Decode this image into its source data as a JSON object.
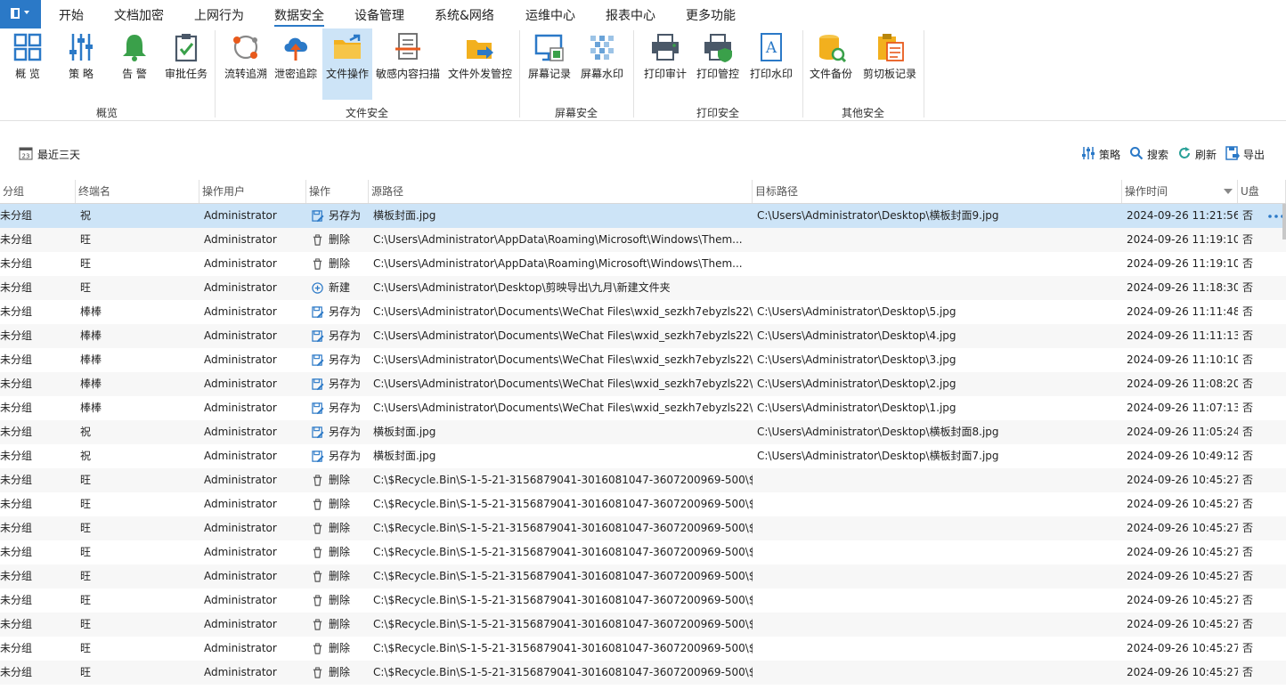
{
  "menu": {
    "items": [
      "开始",
      "文档加密",
      "上网行为",
      "数据安全",
      "设备管理",
      "系统&网络",
      "运维中心",
      "报表中心",
      "更多功能"
    ],
    "active_index": 3
  },
  "ribbon": {
    "groups": [
      {
        "label": "概览",
        "buttons": [
          {
            "label": "概 览",
            "icon": "overview-icon"
          },
          {
            "label": "策 略",
            "icon": "policy-sliders-icon"
          },
          {
            "label": "告 警",
            "icon": "alert-bell-icon"
          },
          {
            "label": "审批任务",
            "icon": "approval-clipboard-icon"
          }
        ]
      },
      {
        "label": "文件安全",
        "buttons": [
          {
            "label": "流转追溯",
            "icon": "flow-trace-icon"
          },
          {
            "label": "泄密追踪",
            "icon": "leak-trace-cloud-icon"
          },
          {
            "label": "文件操作",
            "icon": "file-operation-folder-icon"
          },
          {
            "label": "敏感内容扫描",
            "icon": "sensitive-scan-icon"
          },
          {
            "label": "文件外发管控",
            "icon": "file-outbound-icon"
          }
        ]
      },
      {
        "label": "屏幕安全",
        "buttons": [
          {
            "label": "屏幕记录",
            "icon": "screen-record-icon"
          },
          {
            "label": "屏幕水印",
            "icon": "screen-watermark-icon"
          }
        ]
      },
      {
        "label": "打印安全",
        "buttons": [
          {
            "label": "打印审计",
            "icon": "print-audit-icon"
          },
          {
            "label": "打印管控",
            "icon": "print-control-icon"
          },
          {
            "label": "打印水印",
            "icon": "print-watermark-icon"
          }
        ]
      },
      {
        "label": "其他安全",
        "buttons": [
          {
            "label": "文件备份",
            "icon": "file-backup-icon"
          },
          {
            "label": "剪切板记录",
            "icon": "clipboard-record-icon"
          }
        ]
      }
    ],
    "active_button": "文件操作"
  },
  "toolbar": {
    "date_filter": "最近三天",
    "policy": "策略",
    "search": "搜索",
    "refresh": "刷新",
    "export": "导出"
  },
  "table": {
    "columns": [
      "分组",
      "终端名",
      "操作用户",
      "操作",
      "源路径",
      "目标路径",
      "操作时间",
      "U盘"
    ],
    "sorted_column": "操作时间",
    "rows": [
      {
        "group": "未分组",
        "terminal": "祝",
        "user": "Administrator",
        "op": "另存为",
        "op_icon": "save-as-icon",
        "src": "横板封面.jpg",
        "dst": "C:\\Users\\Administrator\\Desktop\\横板封面9.jpg",
        "time": "2024-09-26 11:21:56",
        "usb": "否"
      },
      {
        "group": "未分组",
        "terminal": "旺",
        "user": "Administrator",
        "op": "删除",
        "op_icon": "delete-trash-icon",
        "src": "C:\\Users\\Administrator\\AppData\\Roaming\\Microsoft\\Windows\\Them...",
        "dst": "",
        "time": "2024-09-26 11:19:10",
        "usb": "否"
      },
      {
        "group": "未分组",
        "terminal": "旺",
        "user": "Administrator",
        "op": "删除",
        "op_icon": "delete-trash-icon",
        "src": "C:\\Users\\Administrator\\AppData\\Roaming\\Microsoft\\Windows\\Them...",
        "dst": "",
        "time": "2024-09-26 11:19:10",
        "usb": "否"
      },
      {
        "group": "未分组",
        "terminal": "旺",
        "user": "Administrator",
        "op": "新建",
        "op_icon": "new-plus-icon",
        "src": "C:\\Users\\Administrator\\Desktop\\剪映导出\\九月\\新建文件夹",
        "dst": "",
        "time": "2024-09-26 11:18:30",
        "usb": "否"
      },
      {
        "group": "未分组",
        "terminal": "棒棒",
        "user": "Administrator",
        "op": "另存为",
        "op_icon": "save-as-icon",
        "src": "C:\\Users\\Administrator\\Documents\\WeChat Files\\wxid_sezkh7ebyzls22\\...",
        "dst": "C:\\Users\\Administrator\\Desktop\\5.jpg",
        "time": "2024-09-26 11:11:48",
        "usb": "否"
      },
      {
        "group": "未分组",
        "terminal": "棒棒",
        "user": "Administrator",
        "op": "另存为",
        "op_icon": "save-as-icon",
        "src": "C:\\Users\\Administrator\\Documents\\WeChat Files\\wxid_sezkh7ebyzls22\\...",
        "dst": "C:\\Users\\Administrator\\Desktop\\4.jpg",
        "time": "2024-09-26 11:11:13",
        "usb": "否"
      },
      {
        "group": "未分组",
        "terminal": "棒棒",
        "user": "Administrator",
        "op": "另存为",
        "op_icon": "save-as-icon",
        "src": "C:\\Users\\Administrator\\Documents\\WeChat Files\\wxid_sezkh7ebyzls22\\...",
        "dst": "C:\\Users\\Administrator\\Desktop\\3.jpg",
        "time": "2024-09-26 11:10:10",
        "usb": "否"
      },
      {
        "group": "未分组",
        "terminal": "棒棒",
        "user": "Administrator",
        "op": "另存为",
        "op_icon": "save-as-icon",
        "src": "C:\\Users\\Administrator\\Documents\\WeChat Files\\wxid_sezkh7ebyzls22\\...",
        "dst": "C:\\Users\\Administrator\\Desktop\\2.jpg",
        "time": "2024-09-26 11:08:20",
        "usb": "否"
      },
      {
        "group": "未分组",
        "terminal": "棒棒",
        "user": "Administrator",
        "op": "另存为",
        "op_icon": "save-as-icon",
        "src": "C:\\Users\\Administrator\\Documents\\WeChat Files\\wxid_sezkh7ebyzls22\\...",
        "dst": "C:\\Users\\Administrator\\Desktop\\1.jpg",
        "time": "2024-09-26 11:07:13",
        "usb": "否"
      },
      {
        "group": "未分组",
        "terminal": "祝",
        "user": "Administrator",
        "op": "另存为",
        "op_icon": "save-as-icon",
        "src": "横板封面.jpg",
        "dst": "C:\\Users\\Administrator\\Desktop\\横板封面8.jpg",
        "time": "2024-09-26 11:05:24",
        "usb": "否"
      },
      {
        "group": "未分组",
        "terminal": "祝",
        "user": "Administrator",
        "op": "另存为",
        "op_icon": "save-as-icon",
        "src": "横板封面.jpg",
        "dst": "C:\\Users\\Administrator\\Desktop\\横板封面7.jpg",
        "time": "2024-09-26 10:49:12",
        "usb": "否"
      },
      {
        "group": "未分组",
        "terminal": "旺",
        "user": "Administrator",
        "op": "删除",
        "op_icon": "delete-trash-icon",
        "src": "C:\\$Recycle.Bin\\S-1-5-21-3156879041-3016081047-3607200969-500\\$...",
        "dst": "",
        "time": "2024-09-26 10:45:27",
        "usb": "否"
      },
      {
        "group": "未分组",
        "terminal": "旺",
        "user": "Administrator",
        "op": "删除",
        "op_icon": "delete-trash-icon",
        "src": "C:\\$Recycle.Bin\\S-1-5-21-3156879041-3016081047-3607200969-500\\$...",
        "dst": "",
        "time": "2024-09-26 10:45:27",
        "usb": "否"
      },
      {
        "group": "未分组",
        "terminal": "旺",
        "user": "Administrator",
        "op": "删除",
        "op_icon": "delete-trash-icon",
        "src": "C:\\$Recycle.Bin\\S-1-5-21-3156879041-3016081047-3607200969-500\\$...",
        "dst": "",
        "time": "2024-09-26 10:45:27",
        "usb": "否"
      },
      {
        "group": "未分组",
        "terminal": "旺",
        "user": "Administrator",
        "op": "删除",
        "op_icon": "delete-trash-icon",
        "src": "C:\\$Recycle.Bin\\S-1-5-21-3156879041-3016081047-3607200969-500\\$...",
        "dst": "",
        "time": "2024-09-26 10:45:27",
        "usb": "否"
      },
      {
        "group": "未分组",
        "terminal": "旺",
        "user": "Administrator",
        "op": "删除",
        "op_icon": "delete-trash-icon",
        "src": "C:\\$Recycle.Bin\\S-1-5-21-3156879041-3016081047-3607200969-500\\$...",
        "dst": "",
        "time": "2024-09-26 10:45:27",
        "usb": "否"
      },
      {
        "group": "未分组",
        "terminal": "旺",
        "user": "Administrator",
        "op": "删除",
        "op_icon": "delete-trash-icon",
        "src": "C:\\$Recycle.Bin\\S-1-5-21-3156879041-3016081047-3607200969-500\\$...",
        "dst": "",
        "time": "2024-09-26 10:45:27",
        "usb": "否"
      },
      {
        "group": "未分组",
        "terminal": "旺",
        "user": "Administrator",
        "op": "删除",
        "op_icon": "delete-trash-icon",
        "src": "C:\\$Recycle.Bin\\S-1-5-21-3156879041-3016081047-3607200969-500\\$...",
        "dst": "",
        "time": "2024-09-26 10:45:27",
        "usb": "否"
      },
      {
        "group": "未分组",
        "terminal": "旺",
        "user": "Administrator",
        "op": "删除",
        "op_icon": "delete-trash-icon",
        "src": "C:\\$Recycle.Bin\\S-1-5-21-3156879041-3016081047-3607200969-500\\$...",
        "dst": "",
        "time": "2024-09-26 10:45:27",
        "usb": "否"
      },
      {
        "group": "未分组",
        "terminal": "旺",
        "user": "Administrator",
        "op": "删除",
        "op_icon": "delete-trash-icon",
        "src": "C:\\$Recycle.Bin\\S-1-5-21-3156879041-3016081047-3607200969-500\\$...",
        "dst": "",
        "time": "2024-09-26 10:45:27",
        "usb": "否"
      }
    ],
    "selected_row": 0
  },
  "colors": {
    "accent": "#2b79c7",
    "selected_row": "#cde4f7",
    "icon_blue": "#2b79c7",
    "icon_green": "#3aa04a",
    "icon_yellow": "#f2b01e",
    "icon_orange": "#e85a1c"
  }
}
